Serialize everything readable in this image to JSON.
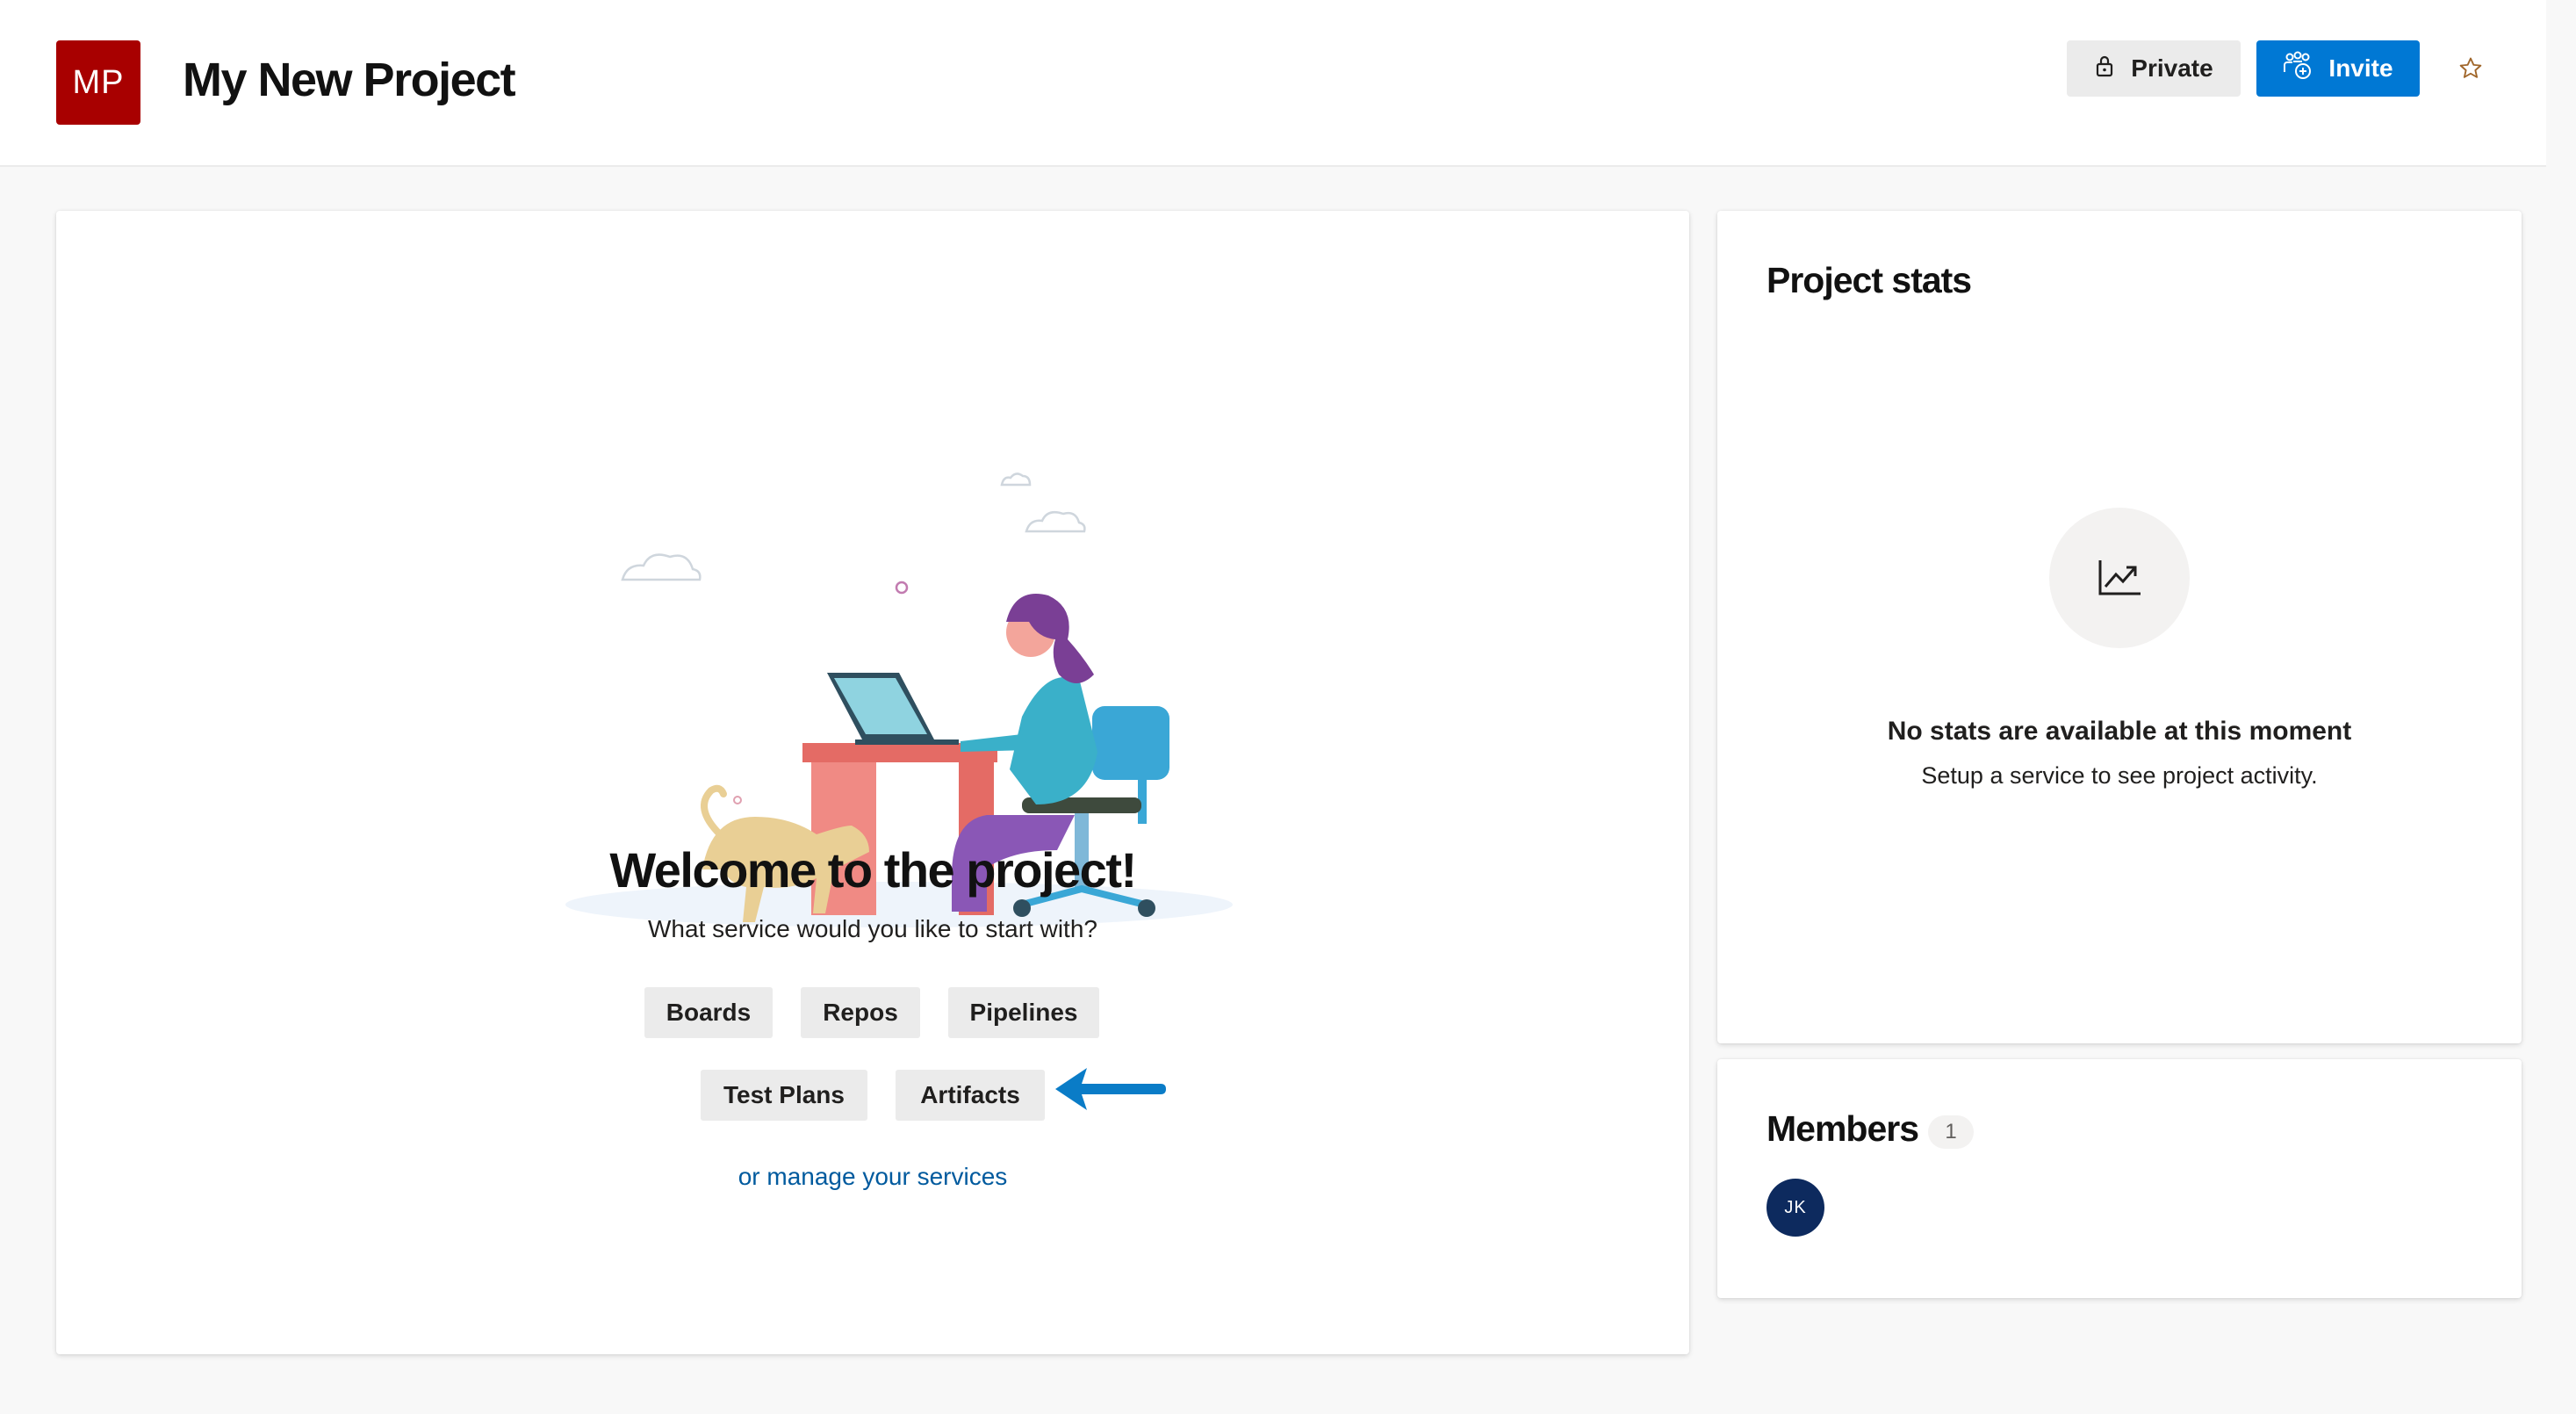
{
  "header": {
    "project_initials": "MP",
    "project_name": "My New Project",
    "private_label": "Private",
    "invite_label": "Invite",
    "icons": [
      "lock-icon",
      "add-people-icon",
      "star-icon"
    ],
    "colors": {
      "project_tile": "#a80000",
      "primary": "#0078d4"
    }
  },
  "welcome": {
    "title": "Welcome to the project!",
    "subtitle": "What service would you like to start with?",
    "services": {
      "boards": "Boards",
      "repos": "Repos",
      "pipelines": "Pipelines",
      "test_plans": "Test Plans",
      "artifacts": "Artifacts"
    },
    "manage_link": "or manage your services"
  },
  "stats": {
    "title": "Project stats",
    "empty_title": "No stats are available at this moment",
    "empty_subtitle": "Setup a service to see project activity.",
    "icon": "line-chart-icon"
  },
  "members": {
    "title": "Members",
    "count": "1",
    "list": [
      {
        "initials": "JK",
        "color": "#0d2a5e"
      }
    ]
  }
}
